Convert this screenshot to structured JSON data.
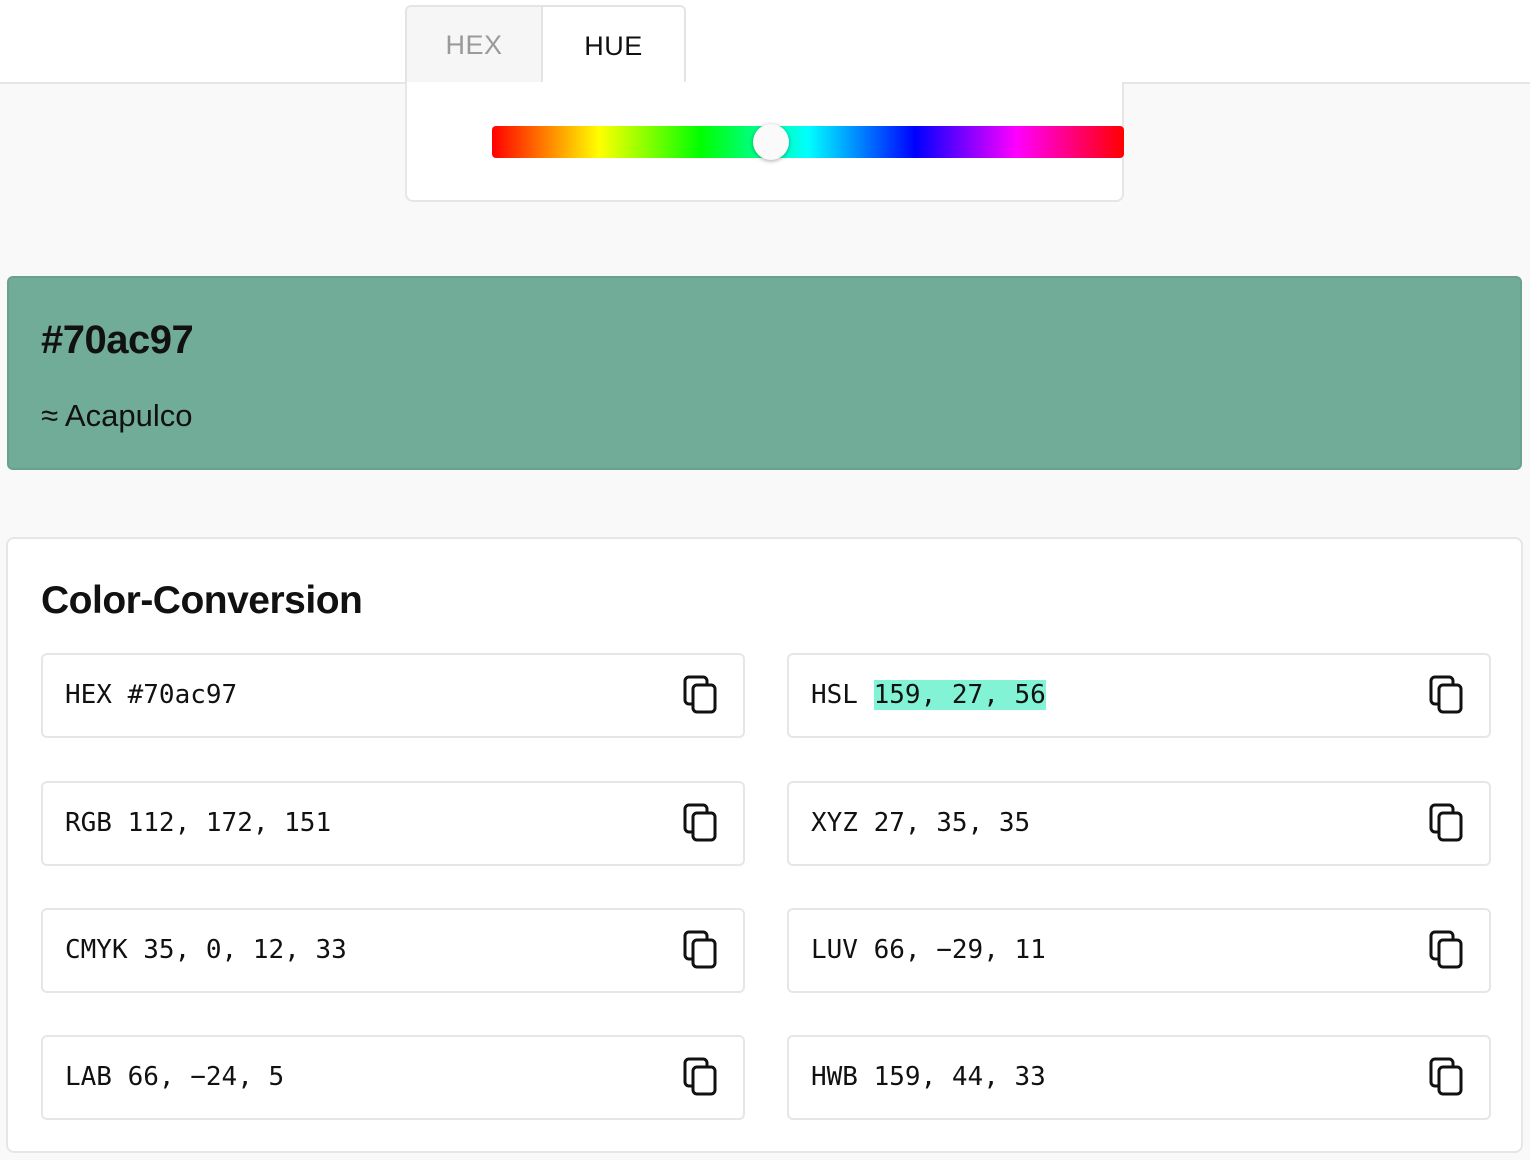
{
  "tabs": [
    {
      "label": "HEX",
      "active": false
    },
    {
      "label": "HUE",
      "active": true
    }
  ],
  "hue_slider": {
    "value": 159,
    "max": 360
  },
  "swatch": {
    "hex": "#70ac97",
    "name": "≈ Acapulco",
    "color": "#70ac97"
  },
  "conversion": {
    "title": "Color-Conversion",
    "items": [
      {
        "label": "HEX",
        "value": "#70ac97"
      },
      {
        "label": "HSL",
        "value": "159, 27, 56",
        "highlighted": true
      },
      {
        "label": "RGB",
        "value": "112, 172, 151"
      },
      {
        "label": "XYZ",
        "value": "27, 35, 35"
      },
      {
        "label": "CMYK",
        "value": "35, 0, 12, 33"
      },
      {
        "label": "LUV",
        "value": "66, −29, 11"
      },
      {
        "label": "LAB",
        "value": "66, −24, 5"
      },
      {
        "label": "HWB",
        "value": "159, 44, 33"
      }
    ],
    "icon": "copy-icon"
  },
  "colors": {
    "highlight": "#83f3d6",
    "page_bg": "#f9f9f9"
  }
}
